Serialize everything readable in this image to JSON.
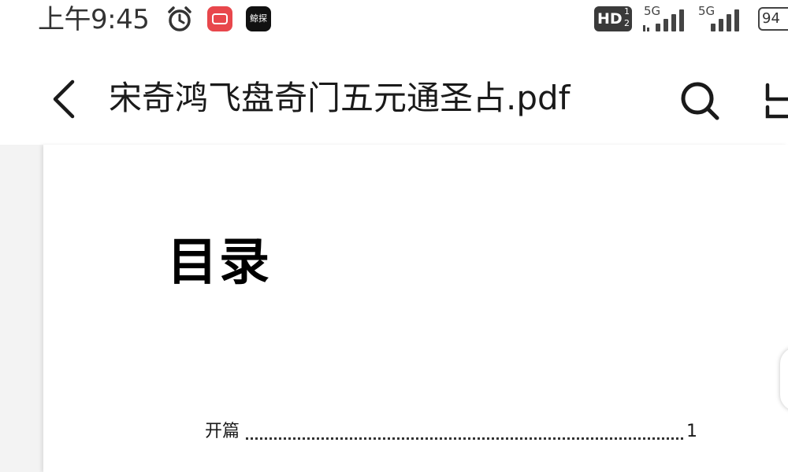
{
  "status_bar": {
    "time": "上午9:45",
    "app_icon_black_label": "鲸探",
    "hd_label": "HD",
    "hd_sup": "1",
    "hd_sub": "2",
    "network_1": "5G",
    "network_2": "5G",
    "battery_level": "94",
    "icons": [
      "alarm-icon",
      "app-icon-red",
      "app-icon-black",
      "signal-icon",
      "battery-icon"
    ]
  },
  "toolbar": {
    "title": "宋奇鸿飞盘奇门五元通圣占.pdf",
    "icons": [
      "back-icon",
      "search-icon",
      "more-icon"
    ]
  },
  "document": {
    "heading": "目录",
    "toc_entries": [
      {
        "label": "开篇",
        "page": "1"
      }
    ]
  },
  "colors": {
    "text_primary": "#1a1a1a",
    "red_app": "#e8474c",
    "viewer_bg": "#f3f3f3",
    "page_bg": "#ffffff"
  }
}
